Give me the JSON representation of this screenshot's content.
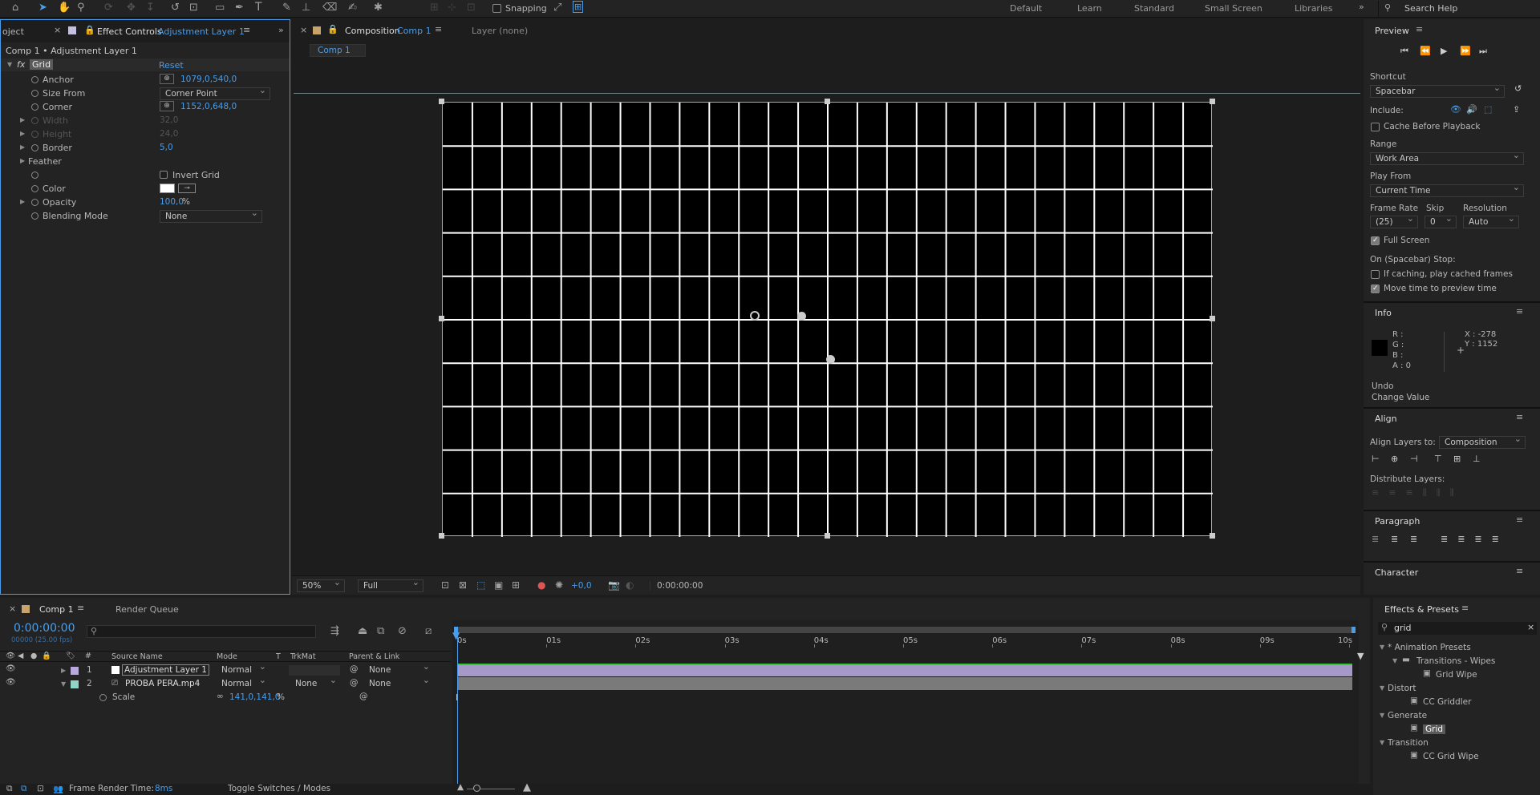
{
  "toolbar": {
    "snapping": "Snapping",
    "workspaces": [
      "Default",
      "Learn",
      "Standard",
      "Small Screen",
      "Libraries"
    ],
    "search_placeholder": "Search Help"
  },
  "left_panel": {
    "tab_project": "oject",
    "tab_effect": "Effect Controls",
    "tab_effect_layer": "Adjustment Layer 1",
    "breadcrumb": "Comp 1 • Adjustment Layer 1",
    "effect_name": "Grid",
    "reset": "Reset",
    "props": [
      {
        "label": "Anchor",
        "value": "1079,0,540,0"
      },
      {
        "label": "Size From",
        "value": "Corner Point"
      },
      {
        "label": "Corner",
        "value": "1152,0,648,0"
      },
      {
        "label": "Width",
        "value": "32,0"
      },
      {
        "label": "Height",
        "value": "24,0"
      },
      {
        "label": "Border",
        "value": "5,0"
      },
      {
        "label": "Feather",
        "value": ""
      },
      {
        "label": "Invert Grid",
        "value": ""
      },
      {
        "label": "Color",
        "value": ""
      },
      {
        "label": "Opacity",
        "value": "100,0",
        "unit": "%"
      },
      {
        "label": "Blending Mode",
        "value": "None"
      }
    ]
  },
  "comp": {
    "tab_label": "Composition",
    "tab_comp": "Comp 1",
    "layer_tab": "Layer (none)",
    "sub_tab": "Comp 1",
    "zoom": "50%",
    "quality": "Full",
    "exposure": "+0,0",
    "timecode": "0:00:00:00",
    "grid_cols": 26,
    "grid_rows": 10
  },
  "preview": {
    "title": "Preview",
    "shortcut_label": "Shortcut",
    "shortcut": "Spacebar",
    "include_label": "Include:",
    "cache": "Cache Before Playback",
    "range_label": "Range",
    "range": "Work Area",
    "play_from_label": "Play From",
    "play_from": "Current Time",
    "frame_rate_label": "Frame Rate",
    "skip_label": "Skip",
    "resolution_label": "Resolution",
    "frame_rate": "(25)",
    "skip": "0",
    "resolution": "Auto",
    "full_screen": "Full Screen",
    "on_stop": "On (Spacebar) Stop:",
    "if_caching": "If caching, play cached frames",
    "move_time": "Move time to preview time"
  },
  "info": {
    "title": "Info",
    "r": "R :",
    "g": "G :",
    "b": "B :",
    "a": "A :  0",
    "x": "X : -278",
    "y": "Y : 1152",
    "undo": "Undo",
    "undo_action": "Change Value"
  },
  "align": {
    "title": "Align",
    "align_to_label": "Align Layers to:",
    "align_to": "Composition",
    "distribute": "Distribute Layers:"
  },
  "paragraph": {
    "title": "Paragraph"
  },
  "character": {
    "title": "Character"
  },
  "timeline": {
    "tab": "Comp 1",
    "render_queue": "Render Queue",
    "timecode": "0:00:00:00",
    "fps": "00000 (25.00 fps)",
    "cols": {
      "source": "Source Name",
      "mode": "Mode",
      "t": "T",
      "trkmat": "TrkMat",
      "parent": "Parent & Link"
    },
    "layers": [
      {
        "num": "1",
        "name": "Adjustment Layer 1",
        "mode": "Normal",
        "trkmat": "",
        "parent": "None",
        "color": "#b9a8e0"
      },
      {
        "num": "2",
        "name": "PROBA PERA.mp4",
        "mode": "Normal",
        "trkmat": "None",
        "parent": "None",
        "color": "#8fd4c6"
      }
    ],
    "scale_label": "Scale",
    "scale_value": "141,0,141,0",
    "scale_unit": "%",
    "ruler": [
      "0s",
      "01s",
      "02s",
      "03s",
      "04s",
      "05s",
      "06s",
      "07s",
      "08s",
      "09s",
      "10s"
    ],
    "frame_render_label": "Frame Render Time:",
    "frame_render_value": "8ms",
    "toggle": "Toggle Switches / Modes"
  },
  "effects_presets": {
    "title": "Effects & Presets",
    "search": "grid",
    "tree": [
      {
        "type": "folder",
        "label": "* Animation Presets",
        "indent": 0
      },
      {
        "type": "folder",
        "label": "Transitions - Wipes",
        "indent": 1
      },
      {
        "type": "item",
        "label": "Grid Wipe",
        "indent": 2
      },
      {
        "type": "folder",
        "label": "Distort",
        "indent": 0
      },
      {
        "type": "item",
        "label": "CC Griddler",
        "indent": 1
      },
      {
        "type": "folder",
        "label": "Generate",
        "indent": 0
      },
      {
        "type": "item",
        "label": "Grid",
        "indent": 1,
        "selected": true
      },
      {
        "type": "folder",
        "label": "Transition",
        "indent": 0
      },
      {
        "type": "item",
        "label": "CC Grid Wipe",
        "indent": 1
      }
    ]
  }
}
